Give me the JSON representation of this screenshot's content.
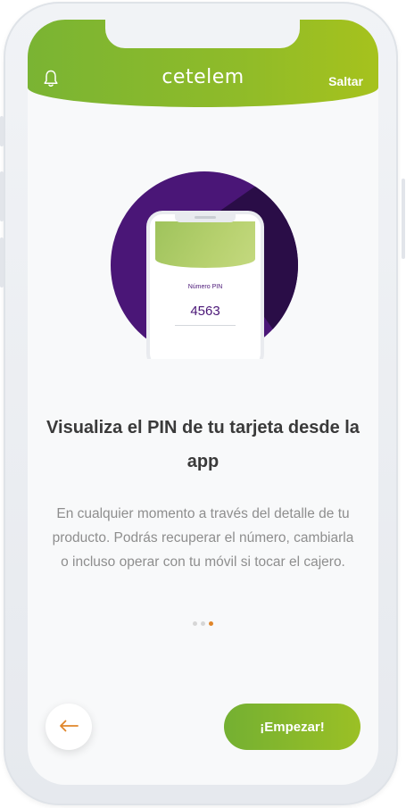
{
  "header": {
    "logo_text": "cetelem",
    "skip_label": "Saltar",
    "bell_icon": "bell-icon"
  },
  "illustration": {
    "pin_label": "Número PIN",
    "pin_value": "4563"
  },
  "content": {
    "title": "Visualiza el PIN de tu tarjeta desde la app",
    "description": "En cualquier momento a través del detalle de tu producto. Podrás recuperar el número, cambiarla o incluso operar con tu móvil si tocar el cajero."
  },
  "pagination": {
    "count": 3,
    "active_index": 2
  },
  "footer": {
    "back_icon": "arrow-left-icon",
    "start_label": "¡Empezar!"
  },
  "colors": {
    "brand_green": "#7ab433",
    "accent_orange": "#e0862a",
    "illustration_purple": "#4a1677"
  }
}
